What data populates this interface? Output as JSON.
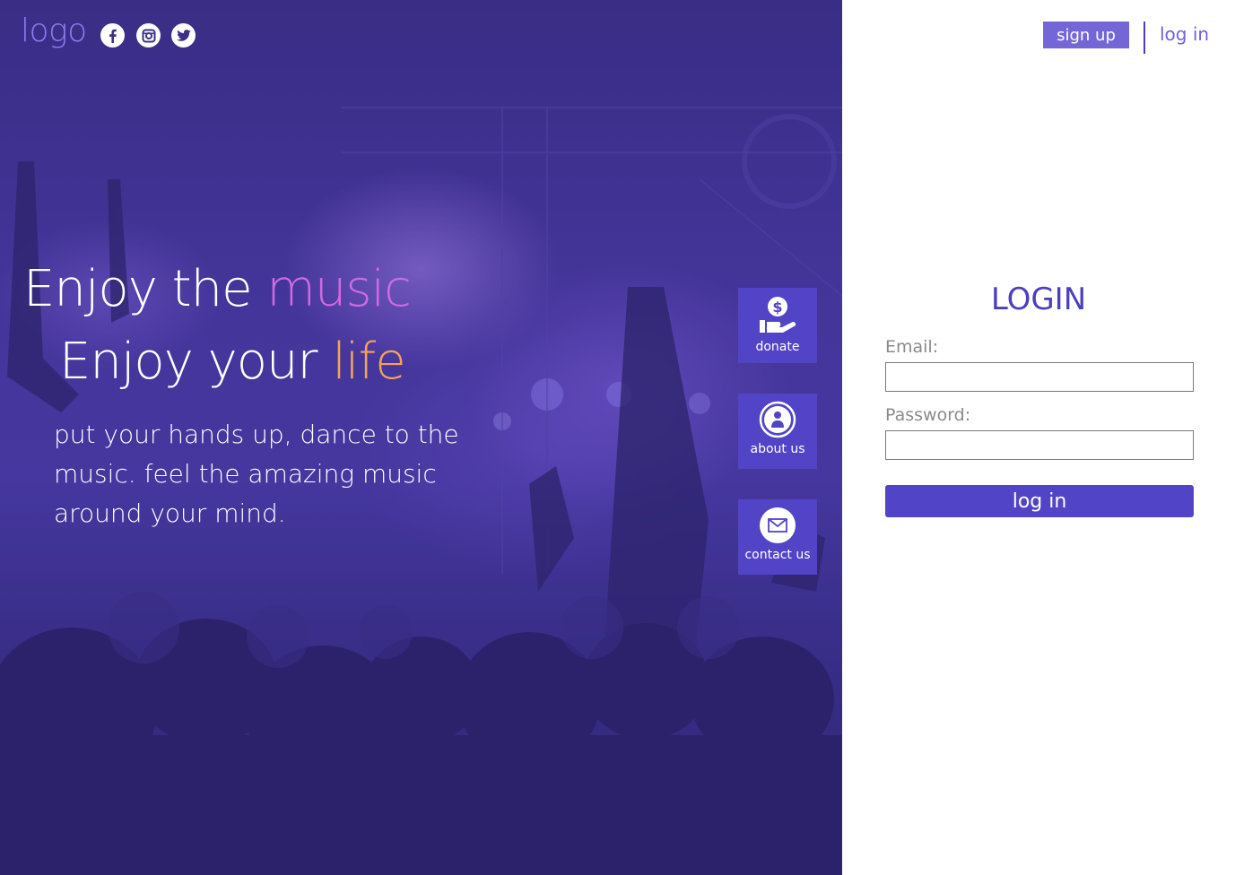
{
  "brand": {
    "logo": "logo"
  },
  "social": [
    {
      "name": "facebook-icon"
    },
    {
      "name": "instagram-icon"
    },
    {
      "name": "twitter-icon"
    }
  ],
  "hero": {
    "line1_prefix": "Enjoy the ",
    "line1_accent": "music",
    "line2_prefix": "Enjoy your ",
    "line2_accent": "life",
    "tagline": "put your hands up, dance to the music. feel the amazing music around your mind."
  },
  "side_actions": {
    "donate": "donate",
    "about": "about us",
    "contact": "contact us"
  },
  "header": {
    "signup": "sign up",
    "login": "log in"
  },
  "login_form": {
    "title": "LOGIN",
    "email_label": "Email:",
    "email_value": "",
    "password_label": "Password:",
    "password_value": "",
    "submit": "log in"
  },
  "colors": {
    "accent": "#5244c6",
    "music": "#d06ae0",
    "life": "#f4a35a",
    "signup_bg": "#7566d8"
  }
}
